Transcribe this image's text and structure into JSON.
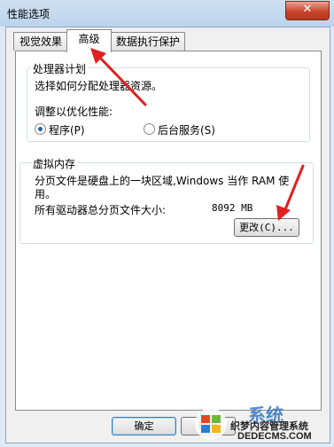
{
  "window": {
    "title": "性能选项",
    "close_label": "✕"
  },
  "tabs": [
    {
      "label": "视觉效果"
    },
    {
      "label": "高级"
    },
    {
      "label": "数据执行保护"
    }
  ],
  "processor": {
    "title": "处理器计划",
    "description": "选择如何分配处理器资源。",
    "optimize_label": "调整以优化性能:",
    "options": [
      {
        "label": "程序(P)",
        "checked": true
      },
      {
        "label": "后台服务(S)",
        "checked": false
      }
    ]
  },
  "virtual_memory": {
    "title": "虚拟内存",
    "description_line1": "分页文件是硬盘上的一块区域,Windows 当作 RAM 使",
    "description_line2": "用。",
    "total_label": "所有驱动器总分页文件大小:",
    "total_value": "8092 MB",
    "change_button": "更改(C)..."
  },
  "footer": {
    "ok_button": "确定",
    "cancel_button": "取消"
  },
  "watermark": {
    "line1": "织梦内容管理系统",
    "line2": "DEDECMS.COM",
    "brand": "系统"
  }
}
